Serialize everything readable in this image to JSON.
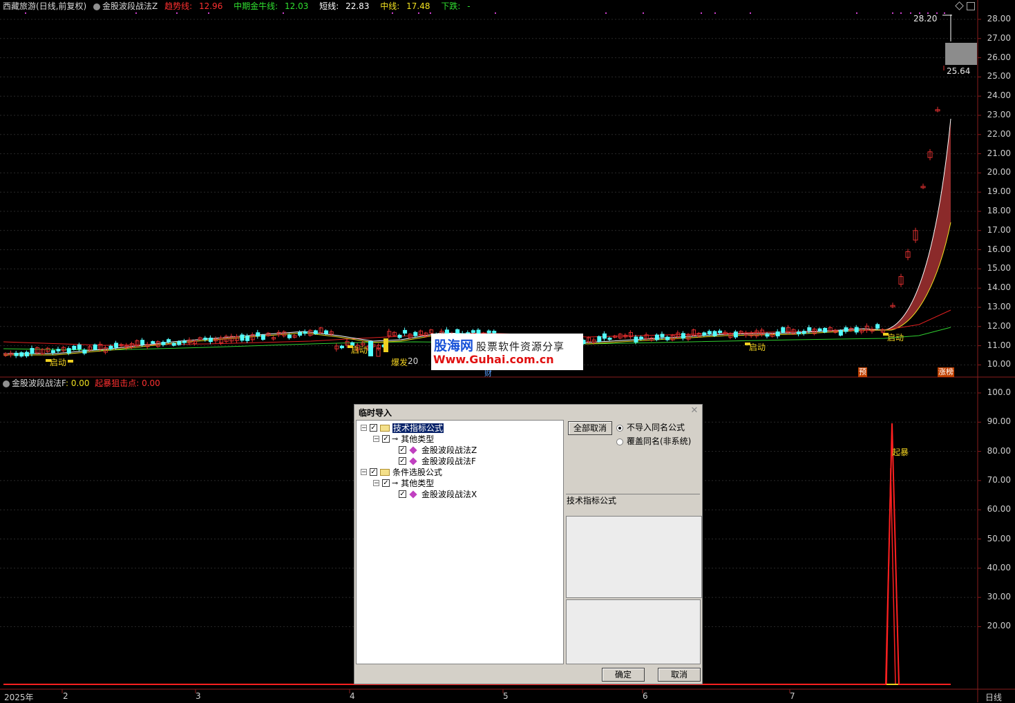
{
  "header": {
    "stock": "西藏旅游",
    "mode": "(日线,前复权)",
    "formula": "金股波段战法Z",
    "trend_label": "趋势线:",
    "trend_value": "12.96",
    "mid_label": "中期金牛线:",
    "mid_value": "12.03",
    "short_label": "短线:",
    "short_value": "22.83",
    "midline_label": "中线:",
    "midline_value": "17.48",
    "down_label": "下跌:",
    "down_value": "-"
  },
  "price_axis": [
    "28.00",
    "27.00",
    "26.00",
    "25.00",
    "24.00",
    "23.00",
    "22.00",
    "21.00",
    "20.00",
    "19.00",
    "18.00",
    "17.00",
    "16.00",
    "15.00",
    "14.00",
    "13.00",
    "12.00",
    "11.00",
    "10.00"
  ],
  "price_markers": {
    "high": "28.20",
    "cur": "25.64"
  },
  "signals": {
    "qidong": "启动",
    "baofa": "爆发",
    "baofa_val": "20",
    "cai": "财",
    "yu": "预",
    "zhangting": "涨榜",
    "qibao": "起暴"
  },
  "sub_header": {
    "formula": "金股波段战法F",
    "f_value": ": 0.00",
    "qibao_label": "起暴狙击点:",
    "qibao_value": "0.00"
  },
  "sub_axis": [
    "100.0",
    "90.00",
    "80.00",
    "70.00",
    "60.00",
    "50.00",
    "40.00",
    "30.00",
    "20.00"
  ],
  "date_axis": {
    "year": "2025年",
    "months": [
      "2",
      "3",
      "4",
      "5",
      "6",
      "7"
    ],
    "period": "日线"
  },
  "watermark": {
    "logo": "股海网",
    "slogan": "股票软件资源分享",
    "url": "Www.Guhai.com.cn"
  },
  "dialog": {
    "title": "临时导入",
    "tree": [
      {
        "label": "技术指标公式",
        "level": 0,
        "kind": "folder"
      },
      {
        "label": "其他类型",
        "level": 1,
        "kind": "key"
      },
      {
        "label": "金股波段战法Z",
        "level": 2,
        "kind": "formula"
      },
      {
        "label": "金股波段战法F",
        "level": 2,
        "kind": "formula"
      },
      {
        "label": "条件选股公式",
        "level": 0,
        "kind": "folder"
      },
      {
        "label": "其他类型",
        "level": 1,
        "kind": "key"
      },
      {
        "label": "金股波段战法X",
        "level": 2,
        "kind": "formula"
      }
    ],
    "cancel_all": "全部取消",
    "radio_skip": "不导入同名公式",
    "radio_overwrite": "覆盖同名(非系统)",
    "group_label": "技术指标公式",
    "ok": "确定",
    "cancel": "取消"
  },
  "colors": {
    "up": "#e03030",
    "down": "#54ffff",
    "trend": "#e02020",
    "mid": "#30d030",
    "short": "#ffffff",
    "midline": "#f0e020",
    "band": "#8b2a2a"
  }
}
